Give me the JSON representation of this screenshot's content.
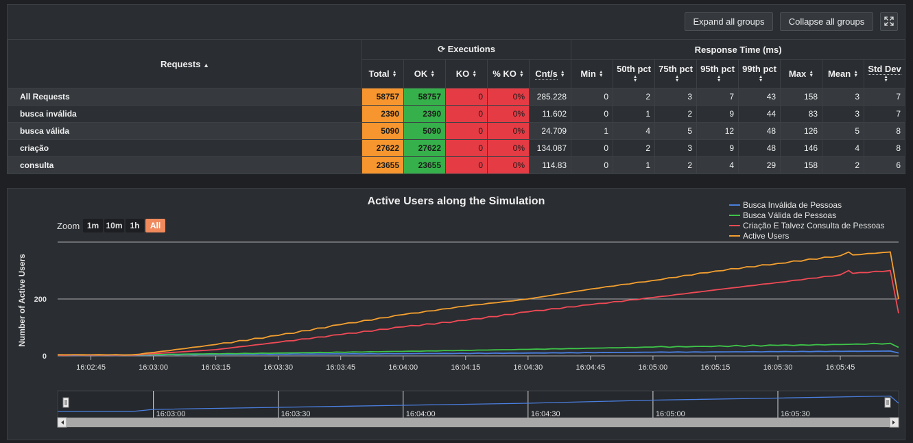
{
  "toolbar": {
    "expand_label": "Expand all groups",
    "collapse_label": "Collapse all groups"
  },
  "table": {
    "requests_header": "Requests",
    "executions_header": "Executions",
    "response_header": "Response Time (ms)",
    "columns": [
      "Total",
      "OK",
      "KO",
      "% KO",
      "Cnt/s",
      "Min",
      "50th pct",
      "75th pct",
      "95th pct",
      "99th pct",
      "Max",
      "Mean",
      "Std Dev"
    ],
    "rows": [
      {
        "name": "All Requests",
        "cells": [
          "58757",
          "58757",
          "0",
          "0%",
          "285.228",
          "0",
          "2",
          "3",
          "7",
          "43",
          "158",
          "3",
          "7"
        ]
      },
      {
        "name": "busca inválida",
        "cells": [
          "2390",
          "2390",
          "0",
          "0%",
          "11.602",
          "0",
          "1",
          "2",
          "9",
          "44",
          "83",
          "3",
          "7"
        ]
      },
      {
        "name": "busca válida",
        "cells": [
          "5090",
          "5090",
          "0",
          "0%",
          "24.709",
          "1",
          "4",
          "5",
          "12",
          "48",
          "126",
          "5",
          "8"
        ]
      },
      {
        "name": "criação",
        "cells": [
          "27622",
          "27622",
          "0",
          "0%",
          "134.087",
          "0",
          "2",
          "3",
          "9",
          "48",
          "146",
          "4",
          "8"
        ]
      },
      {
        "name": "consulta",
        "cells": [
          "23655",
          "23655",
          "0",
          "0%",
          "114.83",
          "0",
          "1",
          "2",
          "4",
          "29",
          "158",
          "2",
          "6"
        ]
      }
    ]
  },
  "zoom": {
    "label": "Zoom",
    "buttons": [
      "1m",
      "10m",
      "1h",
      "All"
    ],
    "active": "All"
  },
  "navigator": {
    "labels": [
      "16:03:00",
      "16:03:30",
      "16:04:00",
      "16:04:30",
      "16:05:00",
      "16:05:30"
    ]
  },
  "chart_data": {
    "type": "line",
    "title": "Active Users along the Simulation",
    "xlabel": "",
    "ylabel": "Number of Active Users",
    "xlim": [
      "16:02:37",
      "16:05:59"
    ],
    "ylim": [
      0,
      400
    ],
    "yticks": [
      0,
      200
    ],
    "xticks": [
      "16:02:45",
      "16:03:00",
      "16:03:15",
      "16:03:30",
      "16:03:45",
      "16:04:00",
      "16:04:15",
      "16:04:30",
      "16:04:45",
      "16:05:00",
      "16:05:15",
      "16:05:30",
      "16:05:45"
    ],
    "grid": true,
    "legend_position": "top-right",
    "series": [
      {
        "name": "Busca Inválida de Pessoas",
        "color": "#4a7fe0",
        "points": [
          [
            "16:02:37",
            2
          ],
          [
            "16:02:55",
            2
          ],
          [
            "16:03:00",
            4
          ],
          [
            "16:03:30",
            6
          ],
          [
            "16:04:00",
            8
          ],
          [
            "16:04:30",
            10
          ],
          [
            "16:05:00",
            13
          ],
          [
            "16:05:30",
            15
          ],
          [
            "16:05:57",
            17
          ],
          [
            "16:05:59",
            10
          ]
        ]
      },
      {
        "name": "Busca Válida de Pessoas",
        "color": "#3ec449",
        "points": [
          [
            "16:02:37",
            3
          ],
          [
            "16:02:55",
            3
          ],
          [
            "16:03:00",
            5
          ],
          [
            "16:03:30",
            10
          ],
          [
            "16:04:00",
            16
          ],
          [
            "16:04:30",
            23
          ],
          [
            "16:05:00",
            31
          ],
          [
            "16:05:30",
            37
          ],
          [
            "16:05:45",
            40
          ],
          [
            "16:05:57",
            44
          ],
          [
            "16:05:59",
            30
          ]
        ]
      },
      {
        "name": "Criação E Talvez Consulta de Pessoas",
        "color": "#f14a56",
        "points": [
          [
            "16:02:37",
            3
          ],
          [
            "16:02:55",
            3
          ],
          [
            "16:03:00",
            8
          ],
          [
            "16:03:15",
            22
          ],
          [
            "16:03:30",
            48
          ],
          [
            "16:03:45",
            75
          ],
          [
            "16:04:00",
            102
          ],
          [
            "16:04:15",
            125
          ],
          [
            "16:04:30",
            155
          ],
          [
            "16:04:45",
            180
          ],
          [
            "16:05:00",
            205
          ],
          [
            "16:05:15",
            232
          ],
          [
            "16:05:30",
            258
          ],
          [
            "16:05:45",
            285
          ],
          [
            "16:05:47",
            300
          ],
          [
            "16:05:48",
            290
          ],
          [
            "16:05:57",
            300
          ],
          [
            "16:05:59",
            150
          ]
        ]
      },
      {
        "name": "Active Users",
        "color": "#f5a030",
        "points": [
          [
            "16:02:37",
            4
          ],
          [
            "16:02:55",
            4
          ],
          [
            "16:03:00",
            12
          ],
          [
            "16:03:15",
            40
          ],
          [
            "16:03:30",
            72
          ],
          [
            "16:03:45",
            110
          ],
          [
            "16:04:00",
            145
          ],
          [
            "16:04:15",
            175
          ],
          [
            "16:04:30",
            200
          ],
          [
            "16:04:45",
            235
          ],
          [
            "16:05:00",
            265
          ],
          [
            "16:05:15",
            298
          ],
          [
            "16:05:30",
            325
          ],
          [
            "16:05:45",
            352
          ],
          [
            "16:05:47",
            365
          ],
          [
            "16:05:48",
            355
          ],
          [
            "16:05:57",
            365
          ],
          [
            "16:05:59",
            200
          ]
        ]
      }
    ]
  }
}
